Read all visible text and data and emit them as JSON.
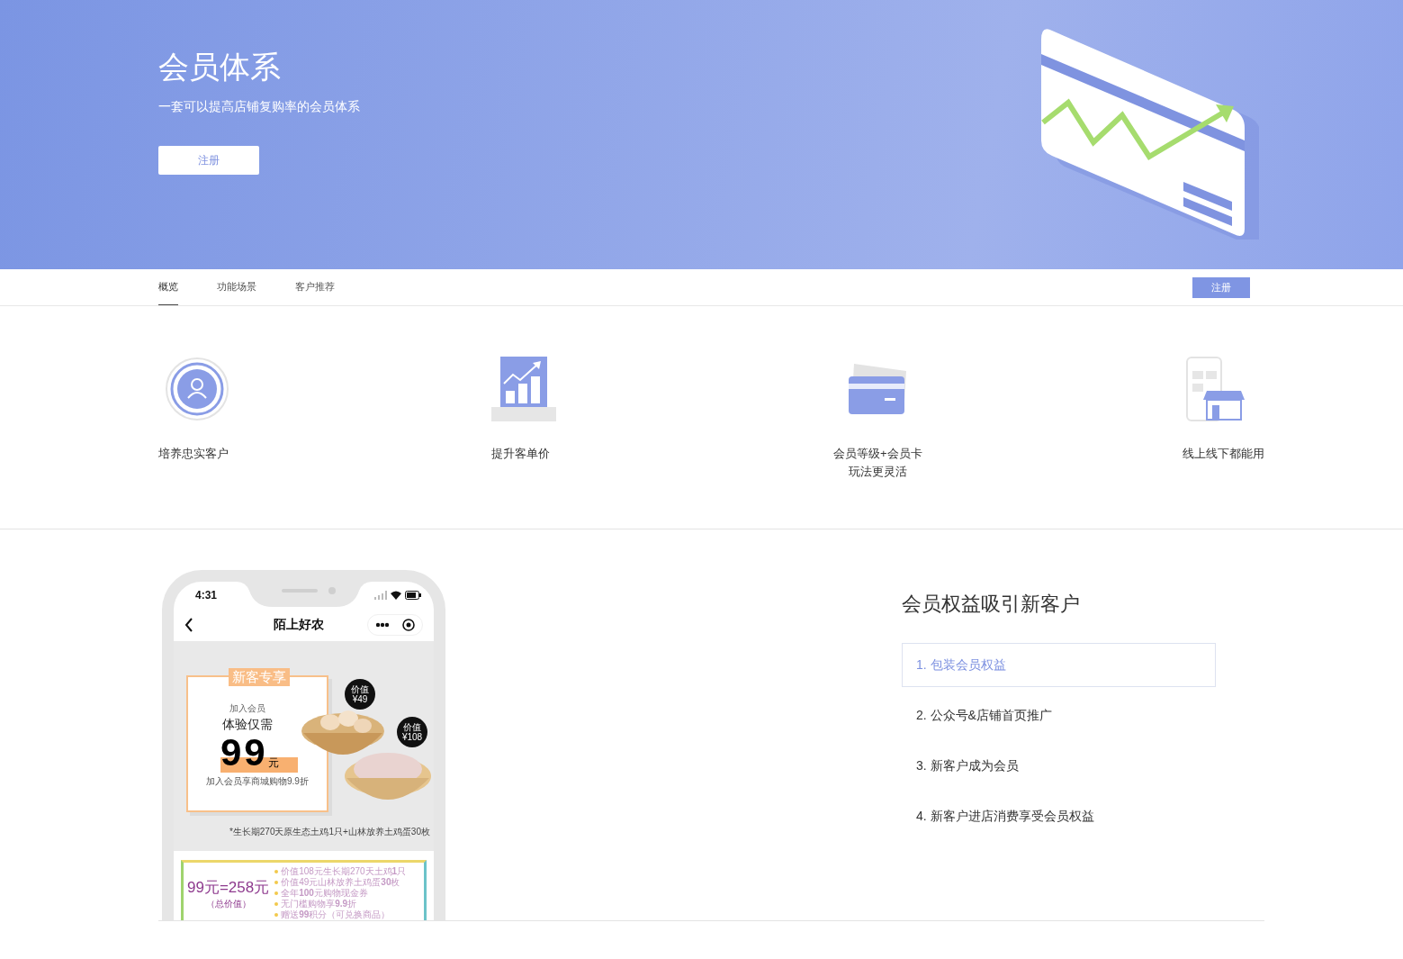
{
  "hero": {
    "title": "会员体系",
    "subtitle": "一套可以提高店铺复购率的会员体系",
    "button": "注册"
  },
  "nav": {
    "tabs": [
      {
        "label": "概览",
        "selected": true
      },
      {
        "label": "功能场景",
        "selected": false
      },
      {
        "label": "客户推荐",
        "selected": false
      }
    ],
    "button": "注册"
  },
  "features": [
    {
      "lines": [
        "培养忠实客户"
      ]
    },
    {
      "lines": [
        "提升客单价"
      ]
    },
    {
      "lines": [
        "会员等级+会员卡",
        "玩法更灵活"
      ]
    },
    {
      "lines": [
        "线上线下都能用"
      ]
    }
  ],
  "showcase": {
    "phone": {
      "time": "4:31",
      "title": "陌上好农",
      "promo": {
        "tag": "新客专享",
        "line1": "加入会员",
        "line2": "体验仅需",
        "price": "99",
        "unit": "元",
        "note": "加入会员享商城购物9.9折",
        "badges": [
          {
            "label": "价值",
            "value": "¥49"
          },
          {
            "label": "价值",
            "value": "¥108"
          }
        ],
        "footnote": "*生长期270天原生态土鸡1只+山林放养土鸡蛋30枚"
      },
      "offer": {
        "price": "99元=258元",
        "caption": "（总价值）",
        "items": [
          "价值108元生长期270天土鸡**1**只",
          "价值49元山林放养土鸡蛋**30**枚",
          "全年**100**元购物现金券",
          "无门槛购物享**9.9**折",
          "赠送**99**积分（可兑换商品）"
        ]
      }
    },
    "title": "会员权益吸引新客户",
    "steps": [
      {
        "label": "1. 包装会员权益",
        "selected": true
      },
      {
        "label": "2. 公众号&店铺首页推广",
        "selected": false
      },
      {
        "label": "3. 新客户成为会员",
        "selected": false
      },
      {
        "label": "4. 新客户进店消费享受会员权益",
        "selected": false
      }
    ]
  }
}
